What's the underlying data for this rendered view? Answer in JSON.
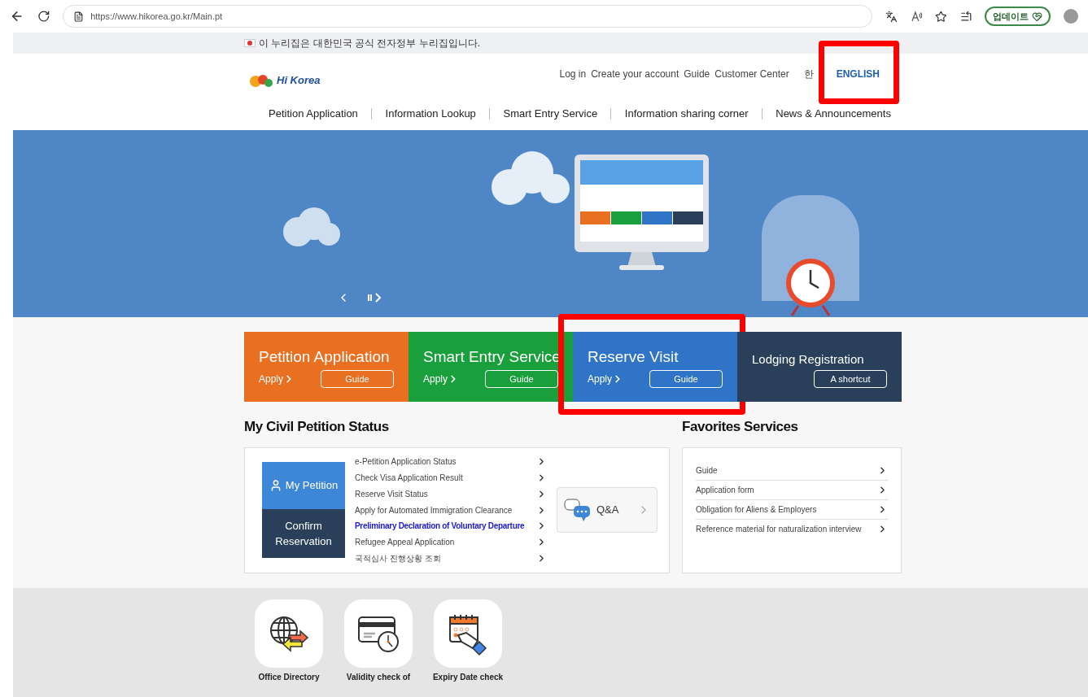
{
  "browser": {
    "url": "https://www.hikorea.go.kr/Main.pt",
    "update_button": "업데이트"
  },
  "gov_banner": {
    "text": "이 누리집은 대한민국 공식 전자정부 누리집입니다."
  },
  "header": {
    "logo": "Hi Korea",
    "top_links": [
      "Log in",
      "Create your account",
      "Guide",
      "Customer Center"
    ],
    "languages": [
      {
        "label": "한",
        "selected": false,
        "highlighted": false
      },
      {
        "label": "ENGLISH",
        "selected": true,
        "highlighted": true
      }
    ],
    "nav": [
      "Petition Application",
      "Information Lookup",
      "Smart Entry Service",
      "Information sharing corner",
      "News & Announcements"
    ]
  },
  "tiles": [
    {
      "kind": "apply",
      "title": "Petition Application",
      "apply": "Apply",
      "button": "Guide",
      "color": "#e96f21",
      "highlighted": false
    },
    {
      "kind": "apply",
      "title": "Smart Entry Service",
      "apply": "Apply",
      "button": "Guide",
      "color": "#1a9f3d",
      "highlighted": false
    },
    {
      "kind": "apply",
      "title": "Reserve Visit",
      "apply": "Apply",
      "button": "Guide",
      "color": "#2f74c6",
      "highlighted": true
    },
    {
      "kind": "shortcut",
      "title": "Lodging Registration",
      "button": "A shortcut",
      "color": "#293f5a",
      "highlighted": false
    }
  ],
  "status": {
    "title": "My Civil Petition Status",
    "my_petition": "My Petition",
    "confirm": "Confirm Reservation",
    "links": [
      {
        "label": "e-Petition Application Status",
        "selected": false
      },
      {
        "label": "Check Visa Application Result",
        "selected": false
      },
      {
        "label": "Reserve Visit Status",
        "selected": false
      },
      {
        "label": "Apply for Automated Immigration Clearance",
        "selected": false
      },
      {
        "label": "Preliminary Declaration of Voluntary Departure",
        "selected": true
      },
      {
        "label": "Refugee Appeal Application",
        "selected": false
      },
      {
        "label": "국적심사 진행상황 조회",
        "selected": false
      }
    ],
    "qna": "Q&A"
  },
  "favorites": {
    "title": "Favorites Services",
    "items": [
      "Guide",
      "Application form",
      "Obligation for Aliens & Employers",
      "Reference material for naturalization interview"
    ]
  },
  "quick_services": [
    {
      "kind": "globe",
      "label": "Office Directory"
    },
    {
      "kind": "card",
      "label": "Validity check of"
    },
    {
      "kind": "calendar",
      "label": "Expiry Date check"
    }
  ]
}
